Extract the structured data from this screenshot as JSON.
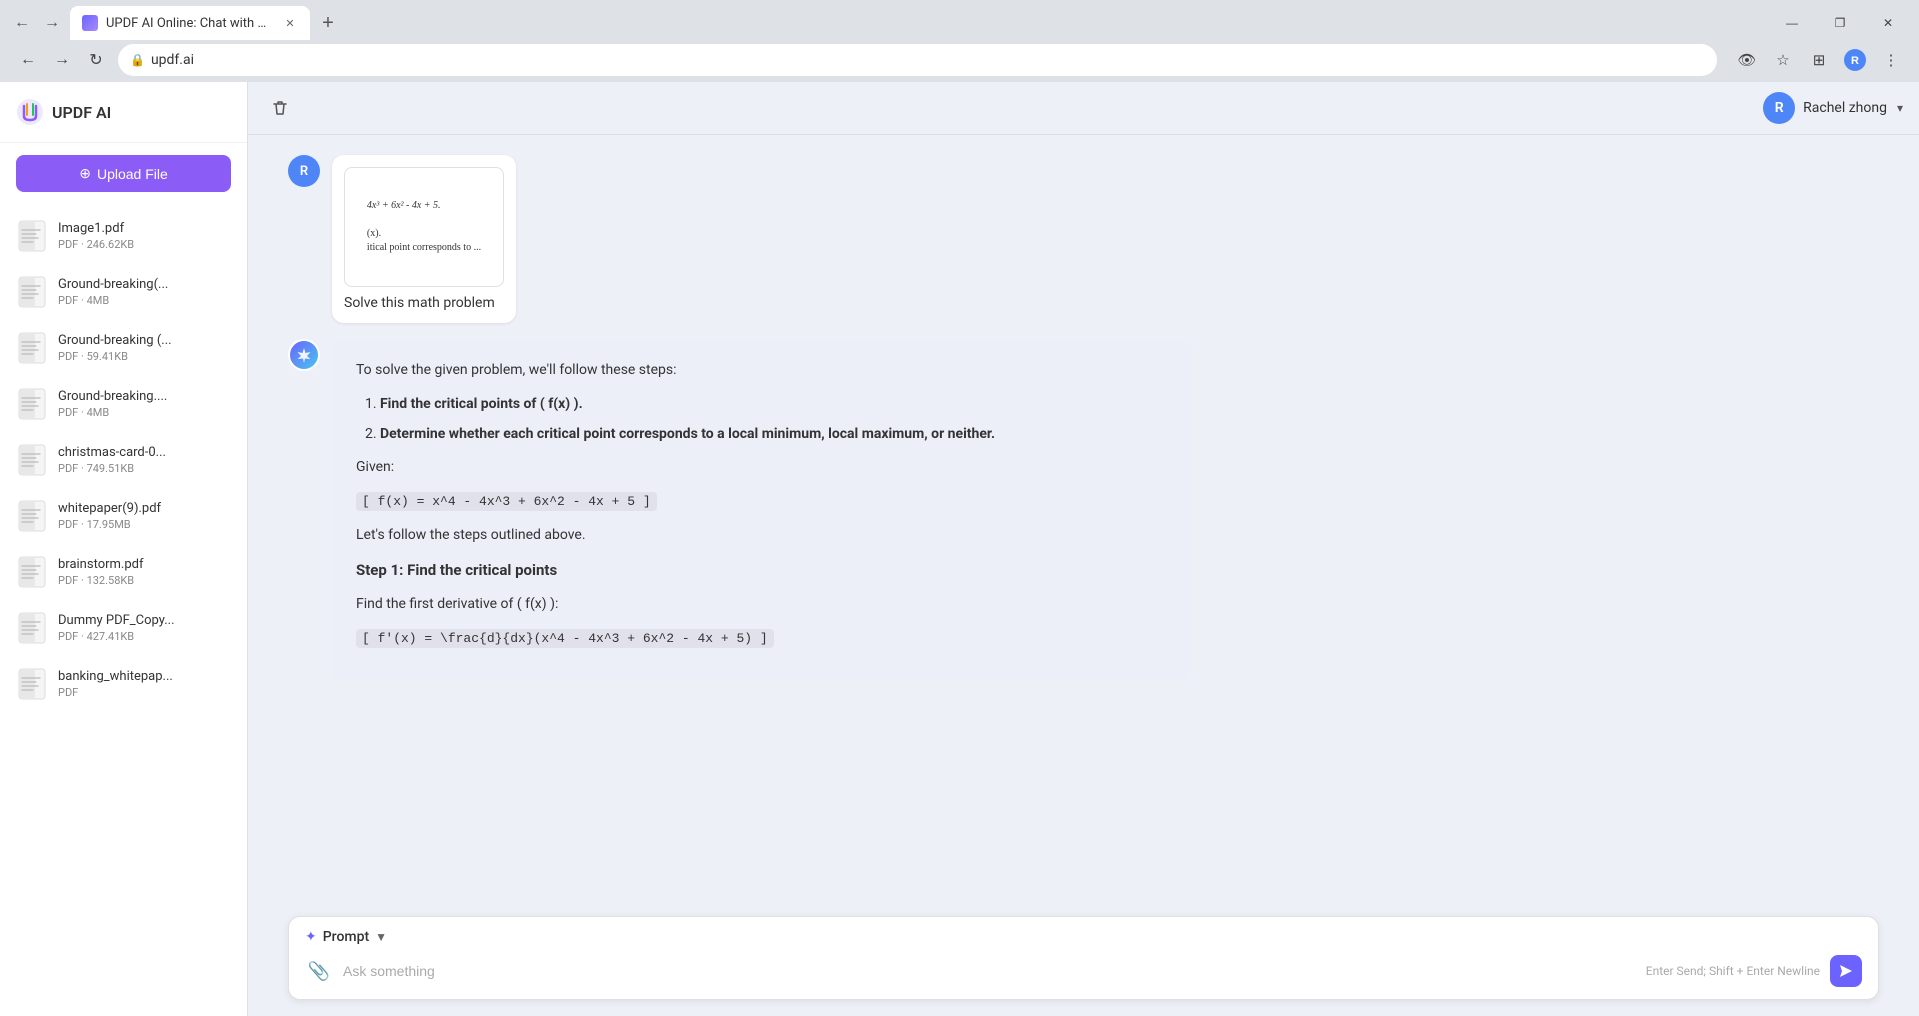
{
  "browser": {
    "tab_label": "UPDF AI Online: Chat with PDF",
    "url": "updf.ai",
    "window_controls": {
      "minimize": "—",
      "maximize": "❐",
      "close": "✕"
    }
  },
  "sidebar": {
    "title": "UPDF AI",
    "upload_button": "Upload File",
    "files": [
      {
        "name": "Image1.pdf",
        "meta": "PDF · 246.62KB"
      },
      {
        "name": "Ground-breaking(...",
        "meta": "PDF · 4MB"
      },
      {
        "name": "Ground-breaking (...",
        "meta": "PDF · 59.41KB"
      },
      {
        "name": "Ground-breaking....",
        "meta": "PDF · 4MB"
      },
      {
        "name": "christmas-card-0...",
        "meta": "PDF · 749.51KB"
      },
      {
        "name": "whitepaper(9).pdf",
        "meta": "PDF · 17.95MB"
      },
      {
        "name": "brainstorm.pdf",
        "meta": "PDF · 132.58KB"
      },
      {
        "name": "Dummy PDF_Copy...",
        "meta": "PDF · 427.41KB"
      },
      {
        "name": "banking_whitepap...",
        "meta": "PDF"
      }
    ]
  },
  "header": {
    "user_name": "Rachel zhong",
    "user_initial": "R"
  },
  "chat": {
    "user_avatar_initial": "R",
    "ai_avatar": "✦",
    "user_message": {
      "pdf_preview": {
        "line1": "4x³ + 6x² - 4x + 5.",
        "line2": "(x).",
        "line3": "itical point corresponds to ..."
      },
      "text": "Solve this math problem"
    },
    "ai_message": {
      "intro": "To solve the given problem, we'll follow these steps:",
      "steps": [
        "Find the critical points of ( f(x) ).",
        "Determine whether each critical point corresponds to a local minimum, local maximum, or neither."
      ],
      "given_label": "Given:",
      "equation": "[ f(x) = x^4 - 4x^3 + 6x^2 - 4x + 5 ]",
      "follow_label": "Let's follow the steps outlined above.",
      "step1_heading": "Step 1: Find the critical points",
      "step1_text": "Find the first derivative of ( f(x) ):",
      "step1_derivative": "[ f'(x) = \\frac{d}{dx}(x^4 - 4x^3 + 6x^2 - 4x + 5) ]"
    }
  },
  "input": {
    "prompt_label": "Prompt",
    "prompt_arrow": "▼",
    "placeholder": "Ask something",
    "hint": "Enter Send; Shift + Enter Newline",
    "attach_icon": "📎",
    "send_icon": "➤"
  },
  "colors": {
    "accent": "#8b5cf6",
    "ai_bubble": "#eceef8",
    "user_bubble": "#ffffff",
    "background": "#eef0f8"
  }
}
